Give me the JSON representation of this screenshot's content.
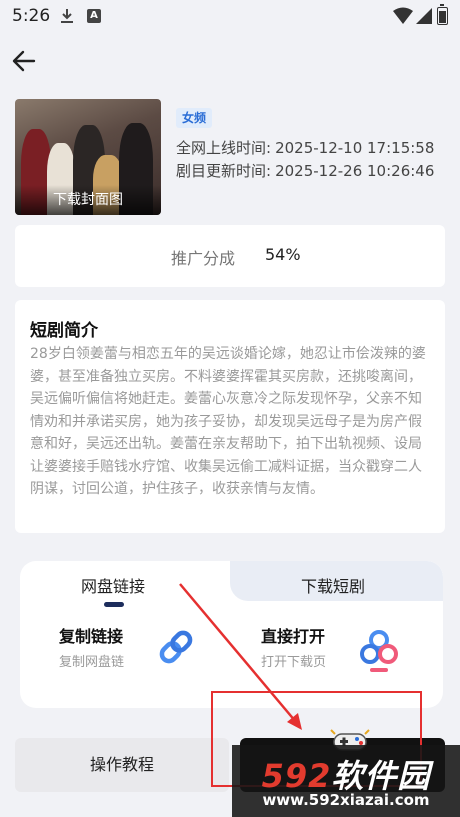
{
  "status": {
    "time": "5:26"
  },
  "drama": {
    "cover_label": "下载封面图",
    "tag": "女频",
    "online_label": "全网上线时间:",
    "online_value": "2025-12-10 17:15:58",
    "update_label": "剧目更新时间:",
    "update_value": "2025-12-26 10:26:46"
  },
  "share": {
    "label": "推广分成",
    "value": "54%"
  },
  "synopsis": {
    "title": "短剧简介",
    "text": "28岁白领姜蕾与相恋五年的吴远谈婚论嫁，她忍让市侩泼辣的婆婆，甚至准备独立买房。不料婆婆挥霍其买房款，还挑唆离间，吴远偏听偏信将她赶走。姜蕾心灰意冷之际发现怀孕，父亲不知情劝和并承诺买房，她为孩子妥协，却发现吴远母子是为房产假意和好，吴远还出轨。姜蕾在亲友帮助下，拍下出轨视频、设局让婆婆接手赔钱水疗馆、收集吴远偷工减料证据，当众戳穿二人阴谋，讨回公道，护住孩子，收获亲情与友情。"
  },
  "tabs": [
    {
      "label": "网盘链接"
    },
    {
      "label": "下载短剧"
    }
  ],
  "actions": {
    "copy_title": "复制链接",
    "copy_sub": "复制网盘链",
    "open_title": "直接打开",
    "open_sub": "打开下载页"
  },
  "bottom": {
    "tutorial_label": "操作教程"
  },
  "watermark": {
    "brand_num": "592",
    "brand_text": "软件园",
    "url": "www.592xiazai.com"
  },
  "colors": {
    "accent": "#2a6dd6",
    "annotation": "#e53030",
    "indicator": "#1d2d5c"
  }
}
